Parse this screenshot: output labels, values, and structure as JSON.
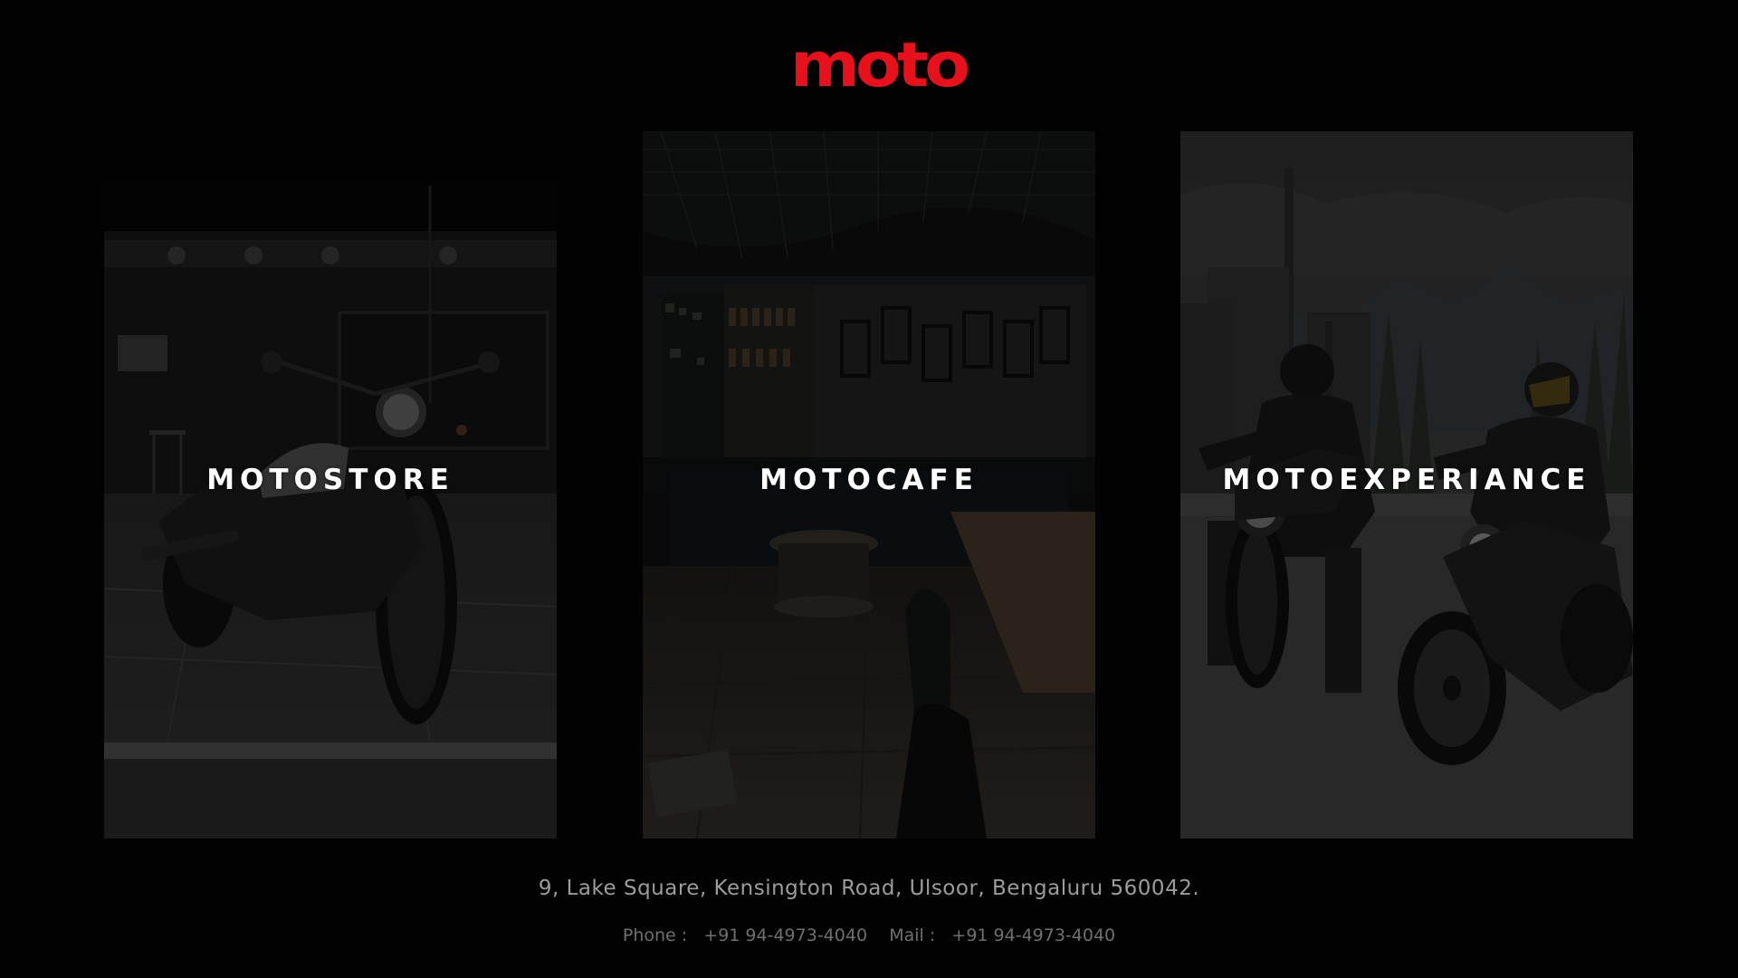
{
  "brand": {
    "logo_text": "moto",
    "logo_color": "#e8101a"
  },
  "cards": [
    {
      "label": "MOTOSTORE",
      "image": "motorcycle-parked-street-photo"
    },
    {
      "label": "MOTOCAFE",
      "image": "cafe-interior-photo"
    },
    {
      "label": "MOTOEXPERIANCE",
      "image": "two-riders-on-motorcycles-photo"
    }
  ],
  "footer": {
    "address": "9, Lake Square, Kensington Road, Ulsoor, Bengaluru 560042.",
    "phone_label": "Phone :",
    "phone_value": "+91 94-4973-4040",
    "mail_label": "Mail :",
    "mail_value": "+91 94-4973-4040"
  },
  "colors": {
    "background": "#020202",
    "card_label": "#ffffff",
    "address_text": "#9c9c9c",
    "contact_text": "#6f6f6f"
  }
}
